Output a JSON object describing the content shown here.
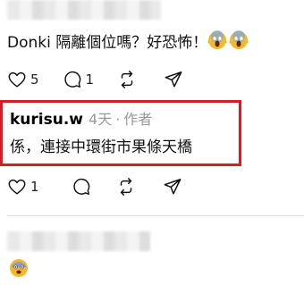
{
  "post1": {
    "text": "Donki 隔離個位嗎？好恐怖！",
    "emoji_icons": [
      "screaming-face-icon",
      "screaming-face-icon"
    ],
    "like_count": "5",
    "reply_count": "1"
  },
  "reply": {
    "username": "kurisu.w",
    "time": "4天",
    "separator": "·",
    "author_label": "作者",
    "text": "係，連接中環街市果條天橋",
    "like_count": "1"
  },
  "post3": {
    "emoji_icon": "anxious-face-icon"
  },
  "colors": {
    "highlight_border": "#d11f25",
    "meta_gray": "#999999",
    "emoji_yellow": "#f6b82b"
  }
}
